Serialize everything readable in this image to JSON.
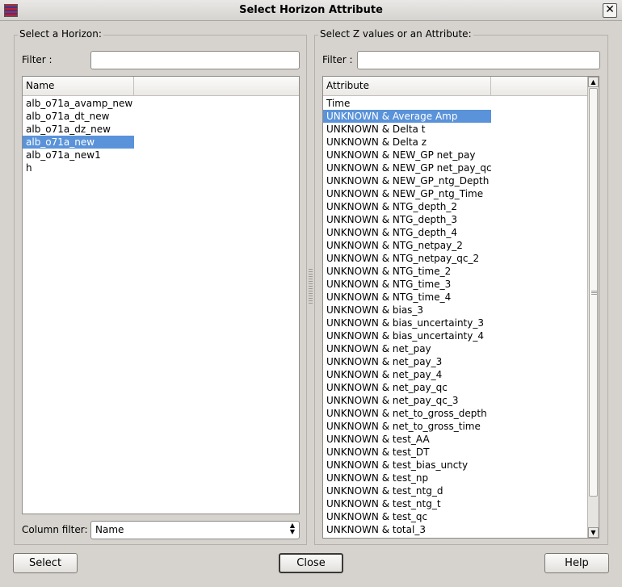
{
  "window": {
    "title": "Select Horizon Attribute",
    "close_glyph": "✕"
  },
  "left": {
    "group_title": "Select a Horizon:",
    "filter_label": "Filter :",
    "filter_value": "",
    "column_header": "Name",
    "items": [
      "alb_o71a_avamp_new",
      "alb_o71a_dt_new",
      "alb_o71a_dz_new",
      "alb_o71a_new",
      "alb_o71a_new1",
      "h"
    ],
    "selected_index": 3,
    "column_filter_label": "Column filter:",
    "column_filter_value": "Name"
  },
  "right": {
    "group_title": "Select Z values or an Attribute:",
    "filter_label": "Filter :",
    "filter_value": "",
    "column_header": "Attribute",
    "items": [
      "Time",
      "UNKNOWN & Average Amp",
      "UNKNOWN & Delta t",
      "UNKNOWN & Delta z",
      "UNKNOWN & NEW_GP net_pay",
      "UNKNOWN & NEW_GP net_pay_qc",
      "UNKNOWN & NEW_GP_ntg_Depth",
      "UNKNOWN & NEW_GP_ntg_Time",
      "UNKNOWN & NTG_depth_2",
      "UNKNOWN & NTG_depth_3",
      "UNKNOWN & NTG_depth_4",
      "UNKNOWN & NTG_netpay_2",
      "UNKNOWN & NTG_netpay_qc_2",
      "UNKNOWN & NTG_time_2",
      "UNKNOWN & NTG_time_3",
      "UNKNOWN & NTG_time_4",
      "UNKNOWN & bias_3",
      "UNKNOWN & bias_uncertainty_3",
      "UNKNOWN & bias_uncertainty_4",
      "UNKNOWN & net_pay",
      "UNKNOWN & net_pay_3",
      "UNKNOWN & net_pay_4",
      "UNKNOWN & net_pay_qc",
      "UNKNOWN & net_pay_qc_3",
      "UNKNOWN & net_to_gross_depth",
      "UNKNOWN & net_to_gross_time",
      "UNKNOWN & test_AA",
      "UNKNOWN & test_DT",
      "UNKNOWN & test_bias_uncty",
      "UNKNOWN & test_np",
      "UNKNOWN & test_ntg_d",
      "UNKNOWN & test_ntg_t",
      "UNKNOWN & test_qc",
      "UNKNOWN & total_3"
    ],
    "selected_index": 1,
    "scroll_up_glyph": "▲",
    "scroll_down_glyph": "▼",
    "scroll_position": 0
  },
  "buttons": {
    "select": "Select",
    "close": "Close",
    "help": "Help"
  },
  "colors": {
    "selection": "#5a93d9",
    "background": "#d6d3ce"
  }
}
